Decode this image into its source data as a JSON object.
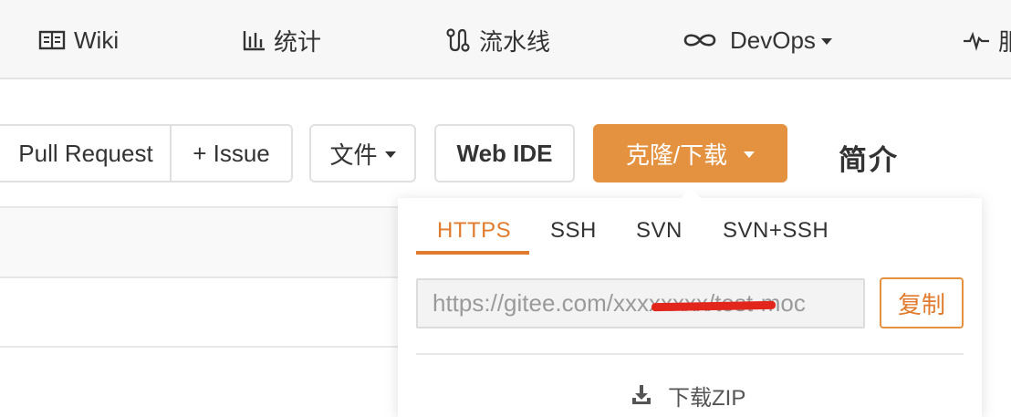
{
  "nav": {
    "items": [
      {
        "label": "Wiki",
        "icon": "book-icon"
      },
      {
        "label": "统计",
        "icon": "bar-chart-icon"
      },
      {
        "label": "流水线",
        "icon": "pipeline-icon"
      },
      {
        "label": "DevOps",
        "icon": "infinity-icon"
      },
      {
        "label": "服",
        "icon": "pulse-icon"
      }
    ]
  },
  "toolbar": {
    "pull_request_label": "Pull Request",
    "issue_label": "+ Issue",
    "files_label": "文件",
    "web_ide_label": "Web IDE",
    "clone_label": "克隆/下载",
    "intro_label": "简介"
  },
  "clone_panel": {
    "tabs": [
      "HTTPS",
      "SSH",
      "SVN",
      "SVN+SSH"
    ],
    "active_tab": "HTTPS",
    "url_value": "https://gitee.com/xxxxxxxx/test-moc",
    "copy_label": "复制",
    "download_label": "下载ZIP"
  },
  "colors": {
    "accent": "#e59240",
    "accent_text": "#e07b2e",
    "redaction": "#e3261c"
  }
}
